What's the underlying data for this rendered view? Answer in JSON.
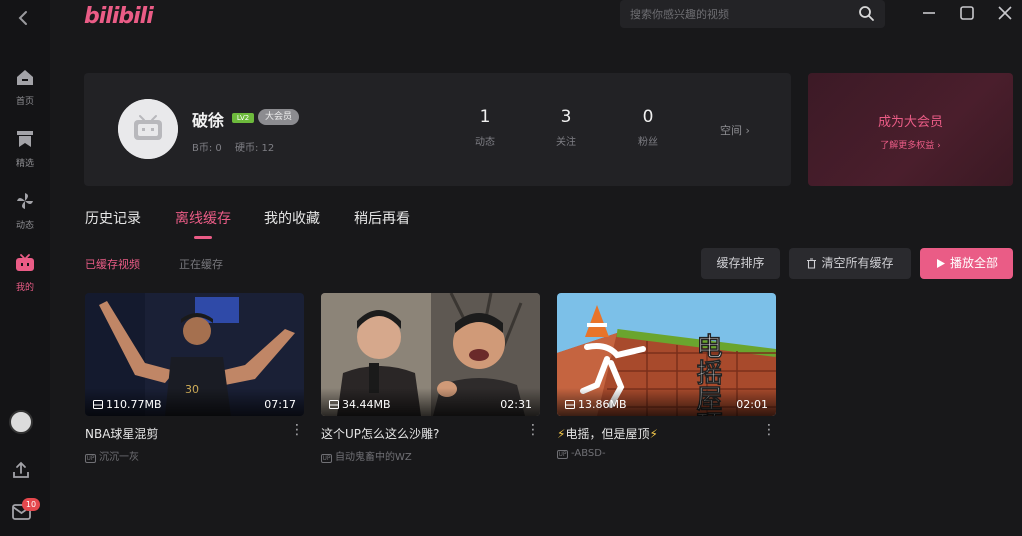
{
  "app": {
    "logo": "bilibili",
    "accent": "#ea5c86"
  },
  "search": {
    "placeholder": "搜索你感兴趣的视频"
  },
  "sidebar": {
    "items": [
      {
        "label": "首页",
        "icon": "home-icon"
      },
      {
        "label": "精选",
        "icon": "bookmark-icon"
      },
      {
        "label": "动态",
        "icon": "pinwheel-icon"
      },
      {
        "label": "我的",
        "icon": "tv-icon",
        "active": true
      }
    ],
    "message_badge": "10"
  },
  "profile": {
    "name": "破徐",
    "level": "LV2",
    "vip_tag": "大会员",
    "coins_label": "B币: 0",
    "hardcoins_label": "硬币: 12",
    "stats": [
      {
        "num": "1",
        "label": "动态"
      },
      {
        "num": "3",
        "label": "关注"
      },
      {
        "num": "0",
        "label": "粉丝"
      }
    ],
    "space_link": "空间 ›"
  },
  "vip_card": {
    "title": "成为大会员",
    "more": "了解更多权益 ›"
  },
  "tabs": [
    "历史记录",
    "离线缓存",
    "我的收藏",
    "稍后再看"
  ],
  "active_tab": "离线缓存",
  "subtabs": [
    "已缓存视频",
    "正在缓存"
  ],
  "buttons": {
    "sort": "缓存排序",
    "clear": "清空所有缓存",
    "play_all": "播放全部"
  },
  "videos": [
    {
      "title": "NBA球星混剪",
      "size": "110.77MB",
      "duration": "07:17",
      "author": "沉沉一灰"
    },
    {
      "title": "这个UP怎么这么沙雕?",
      "size": "34.44MB",
      "duration": "02:31",
      "author": "自动鬼畜中的WZ"
    },
    {
      "title": "电摇，但是屋顶",
      "size": "13.86MB",
      "duration": "02:01",
      "author": "-ABSD-",
      "thumb_text": "电摇屋顶"
    }
  ]
}
